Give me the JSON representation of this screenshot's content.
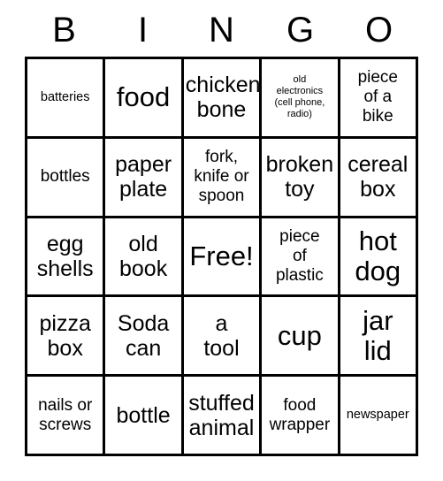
{
  "header": {
    "letters": [
      "B",
      "I",
      "N",
      "G",
      "O"
    ]
  },
  "grid": {
    "rows": [
      [
        {
          "text": "batteries",
          "size": "s"
        },
        {
          "text": "food",
          "size": "xl"
        },
        {
          "text": "chicken\nbone",
          "size": "l"
        },
        {
          "text": "old\nelectronics\n(cell phone,\nradio)",
          "size": "xs"
        },
        {
          "text": "piece\nof a\nbike",
          "size": "m"
        }
      ],
      [
        {
          "text": "bottles",
          "size": "m"
        },
        {
          "text": "paper\nplate",
          "size": "l"
        },
        {
          "text": "fork,\nknife or\nspoon",
          "size": "m"
        },
        {
          "text": "broken\ntoy",
          "size": "l"
        },
        {
          "text": "cereal\nbox",
          "size": "l"
        }
      ],
      [
        {
          "text": "egg\nshells",
          "size": "l"
        },
        {
          "text": "old\nbook",
          "size": "l"
        },
        {
          "text": "Free!",
          "size": "xl"
        },
        {
          "text": "piece\nof\nplastic",
          "size": "m"
        },
        {
          "text": "hot\ndog",
          "size": "xl"
        }
      ],
      [
        {
          "text": "pizza\nbox",
          "size": "l"
        },
        {
          "text": "Soda\ncan",
          "size": "l"
        },
        {
          "text": "a\ntool",
          "size": "l"
        },
        {
          "text": "cup",
          "size": "xl"
        },
        {
          "text": "jar\nlid",
          "size": "xl"
        }
      ],
      [
        {
          "text": "nails or\nscrews",
          "size": "m"
        },
        {
          "text": "bottle",
          "size": "l"
        },
        {
          "text": "stuffed\nanimal",
          "size": "l"
        },
        {
          "text": "food\nwrapper",
          "size": "m"
        },
        {
          "text": "newspaper",
          "size": "s"
        }
      ]
    ]
  },
  "colors": {
    "ink": "#000000",
    "paper": "#ffffff"
  }
}
